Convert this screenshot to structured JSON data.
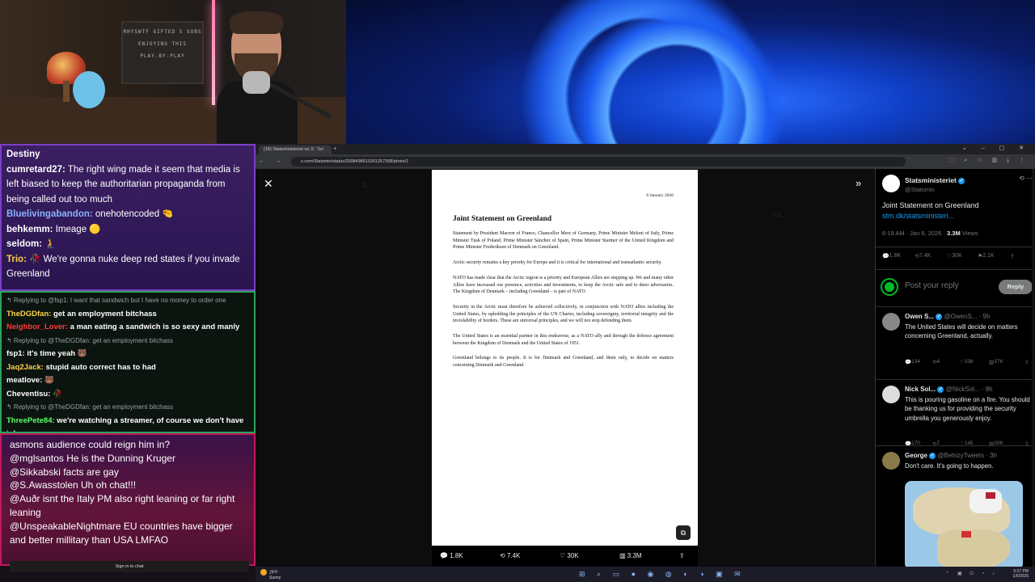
{
  "stream": {
    "board_text": [
      "RHYSWTF GIFTED 5 SUBS",
      "ENJOYING THIS",
      "PLAY-BY-PLAY"
    ]
  },
  "chat_top": [
    {
      "user": "Destiny",
      "msg": "",
      "color": "#ffffff"
    },
    {
      "user": "cumretard27:",
      "msg": " The right wing made it seem that media is left biased to keep the authoritarian propaganda from being called out too much",
      "color": "#ffffff"
    },
    {
      "user": "Bluelivingabandon:",
      "msg": " onehotencoded 🤏",
      "color": "#8ab4ff"
    },
    {
      "user": "behkemm:",
      "msg": " Imeage 🟡",
      "color": "#ffffff"
    },
    {
      "user": "seldom:",
      "msg": " 🧎",
      "color": "#ffffff"
    },
    {
      "user": "Trio:",
      "msg": " 🥀 We're gonna nuke deep red states if you invade Greenland",
      "color": "#ffd24a"
    }
  ],
  "chat_mid": [
    {
      "reply": "↰ Replying to @fsp1: I want that sandwich but I have no money to order one"
    },
    {
      "user": "TheDGDfan:",
      "msg": " get an employment bitchass",
      "color": "#ffd24a"
    },
    {
      "user": "Neighbor_Lover:",
      "msg": " a man eating a sandwich is so sexy and manly",
      "color": "#ff3b3b"
    },
    {
      "reply": "↰ Replying to @TheDGDfan: get an employment bitchass"
    },
    {
      "user": "fsp1:",
      "msg": " it's time yeah 🐻",
      "color": "#ffffff"
    },
    {
      "user": "Jaq2Jack:",
      "msg": " stupid auto correct has to had",
      "color": "#ffd24a"
    },
    {
      "user": "meatlove:",
      "msg": " 🐻",
      "color": "#ffffff"
    },
    {
      "user": "Cheventisu:",
      "msg": " 🥀",
      "color": "#ffffff"
    },
    {
      "reply": "↰ Replying to @TheDGDfan: get an employment bitchass"
    },
    {
      "user": "ThreePete84:",
      "msg": " we're watching a streamer, of course we don't have jobs",
      "color": "#5dff6a"
    }
  ],
  "chat_bottom": [
    {
      "user": "",
      "msg": "asmons audience could reign him in?"
    },
    {
      "user": "@mglsantos",
      "msg": " He is the Dunning Kruger"
    },
    {
      "user": "@Sikkabski",
      "msg": " facts are gay"
    },
    {
      "user": "@S.Awasstolen",
      "msg": " Uh oh chat!!!"
    },
    {
      "user": "@Auðr",
      "msg": " isnt the Italy PM also right leaning or far right leaning"
    },
    {
      "user": "@UnspeakableNightmare",
      "msg": " EU countries have bigger and better millitary than USA LMFAO"
    }
  ],
  "chat_signin": "Sign in to chat",
  "browser": {
    "tab_title": "(18) Statsministeriet on X: \"Joi",
    "url": "x.com/Statsmin/status/2008498610261257368/photo/1"
  },
  "document": {
    "date": "6 January 2026",
    "title": "Joint Statement on Greenland",
    "paragraphs": [
      "Statement by President Macron of France, Chancellor Merz of Germany, Prime Minister Meloni of Italy, Prime Minister Tusk of Poland, Prime Minister Sánchez of Spain, Prime Minister Starmer of the United Kingdom and Prime Minister Frederiksen of Denmark on Greenland.",
      "Arctic security remains a key priority for Europe and it is critical for international and transatlantic security.",
      "NATO has made clear that the Arctic region is a priority and European Allies are stepping up. We and many other Allies have increased our presence, activities and investments, to keep the Arctic safe and to deter adversaries. The Kingdom of Denmark – including Greenland – is part of NATO.",
      "Security in the Arctic must therefore be achieved collectively, in conjunction with NATO allies including the United States, by upholding the principles of the UN Charter, including sovereignty, territorial integrity and the inviolability of borders. These are universal principles, and we will not stop defending them.",
      "The United States is an essential partner in this endeavour, as a NATO ally and through the defence agreement between the Kingdom of Denmark and the United States of 1951.",
      "Greenland belongs to its people. It is for Denmark and Greenland, and them only, to decide on matters concerning Denmark and Greenland."
    ]
  },
  "photo_actions": {
    "replies": "1.8K",
    "reposts": "7.4K",
    "likes": "30K",
    "views": "3.3M"
  },
  "post": {
    "name": "Statsministeriet",
    "handle": "@Statsmin",
    "text": "Joint Statement on Greenland",
    "link": "stm.dk/statsministeri...",
    "time": "6:19 AM · Jan 6, 2026 · ",
    "views": "3.3M",
    "views_label": " Views",
    "replies": "1.8K",
    "reposts": "7.4K",
    "likes": "30K",
    "bookmarks": "2.1K",
    "reply_placeholder": "Post your reply",
    "reply_button": "Reply"
  },
  "replies": [
    {
      "name": "Owen S...",
      "handle": "@OwenS...",
      "time": "· 9h",
      "text": "The United States will decide on matters concerning Greenland, actually.",
      "replies": "134",
      "reposts": "4",
      "likes": "338",
      "views": "37K"
    },
    {
      "name": "Nick Sol...",
      "handle": "@NickSol...",
      "time": "· 8h",
      "text": "This is pouring gasoline on a fire. You should be thanking us for providing the security umbrella you generously enjoy.",
      "replies": "170",
      "reposts": "7",
      "likes": "145",
      "views": "30K"
    },
    {
      "name": "George",
      "handle": "@BehizyTweets",
      "time": "· 3h",
      "text": "Don't care. It's going to happen."
    }
  ],
  "taskbar": {
    "weather_temp": "29°F",
    "weather_desc": "Sunny",
    "time": "5:37 PM",
    "date": "1/6/2026"
  },
  "colors": {
    "x_blue": "#1d9bf0",
    "chat_top_border": "#7b3fc6",
    "chat_mid_border": "#2aa35a",
    "chat_bottom_border": "#c2185b"
  }
}
